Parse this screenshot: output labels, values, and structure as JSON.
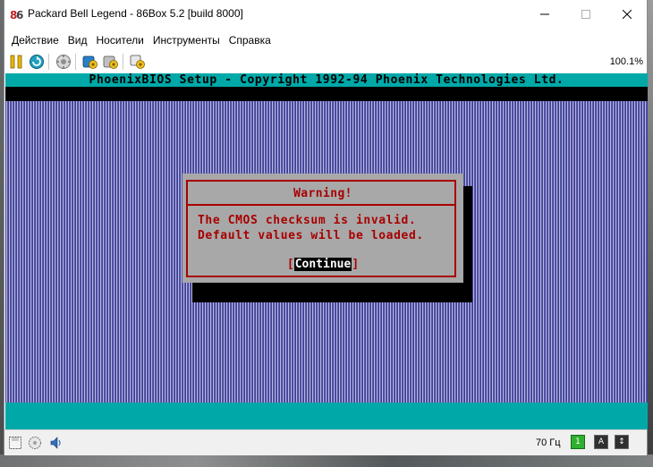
{
  "window": {
    "title": "Packard Bell Legend - 86Box 5.2 [build 8000]"
  },
  "menu": {
    "items": [
      "Действие",
      "Вид",
      "Носители",
      "Инструменты",
      "Справка"
    ]
  },
  "toolbar": {
    "icons": [
      "pause-icon",
      "reset-icon",
      "ctrl-alt-del-icon",
      "settings-icon",
      "hard-reset-icon",
      "screenshot-icon"
    ],
    "zoom": "100.1%"
  },
  "bios": {
    "header": "PhoenixBIOS Setup - Copyright 1992-94 Phoenix Technologies Ltd.",
    "dialog": {
      "title": "Warning!",
      "line1": "The CMOS checksum is invalid.",
      "line2": "Default values will be loaded.",
      "bracket_left": "[",
      "button": "Continue",
      "bracket_right": "]"
    },
    "colors": {
      "header_bg": "#00a8a8",
      "dialog_bg": "#a8a8a8",
      "dialog_text": "#a80000"
    }
  },
  "statusbar": {
    "refresh_rate": "70 Гц",
    "indicators": [
      "1",
      "A",
      "↕"
    ]
  }
}
